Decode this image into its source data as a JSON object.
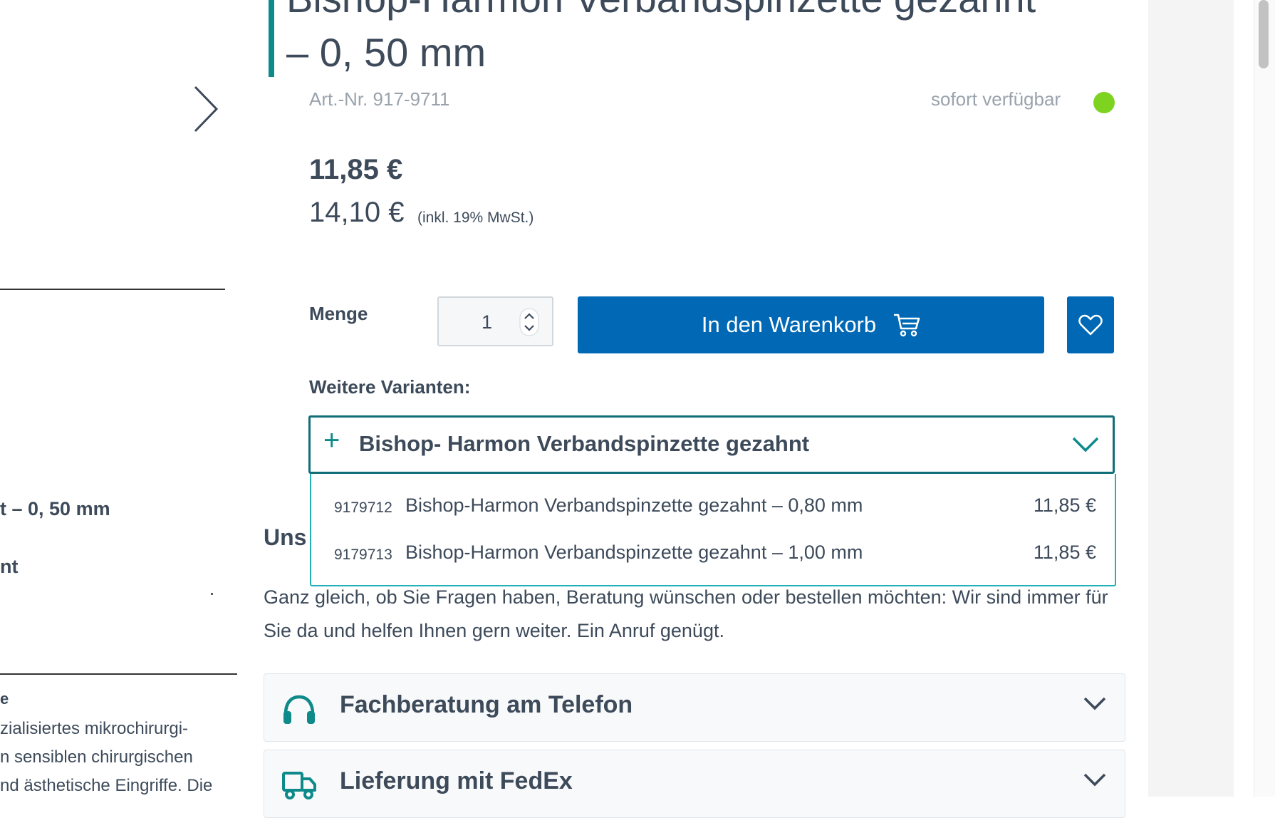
{
  "product": {
    "title_line1": "Bishop-Harmon Verbandspinzette gezahnt",
    "title_line2": "– 0, 50 mm",
    "art_nr": "Art.-Nr. 917-9711",
    "availability": "sofort verfügbar",
    "availability_color": "#7ed321",
    "price_net": "11,85 €",
    "price_gross": "14,10 €",
    "price_note": "(inkl. 19% MwSt.)"
  },
  "left_panel": {
    "title_fragment": "t – 0, 50 mm",
    "sub_fragment": "nt",
    "heading_fragment": "e",
    "desc_lines": [
      "zialisiertes mikrochirurgi-",
      "n sensiblen chirurgischen",
      "nd ästhetische Eingriffe. Die"
    ]
  },
  "purchase": {
    "quantity_label": "Menge",
    "quantity_value": "1",
    "cart_button": "In den Warenkorb",
    "accent_color": "#0068b4"
  },
  "variants": {
    "label": "Weitere Varianten:",
    "selected": "Bishop- Harmon Verbandspinzette gezahnt",
    "items": [
      {
        "num": "9179712",
        "name": "Bishop-Harmon Verbandspinzette gezahnt – 0,80 mm",
        "price": "11,85 €"
      },
      {
        "num": "9179713",
        "name": "Bishop-Harmon Verbandspinzette gezahnt – 1,00 mm",
        "price": "11,85 €"
      }
    ]
  },
  "service": {
    "title": "Uns",
    "text": "Ganz gleich, ob Sie Fragen haben, Beratung wünschen oder bestellen möchten: Wir sind immer für Sie da und helfen Ihnen gern weiter. Ein Anruf genügt.",
    "accordions": [
      {
        "label": "Fachberatung am Telefon",
        "icon": "headset-icon"
      },
      {
        "label": "Lieferung mit FedEx",
        "icon": "truck-icon"
      }
    ]
  }
}
